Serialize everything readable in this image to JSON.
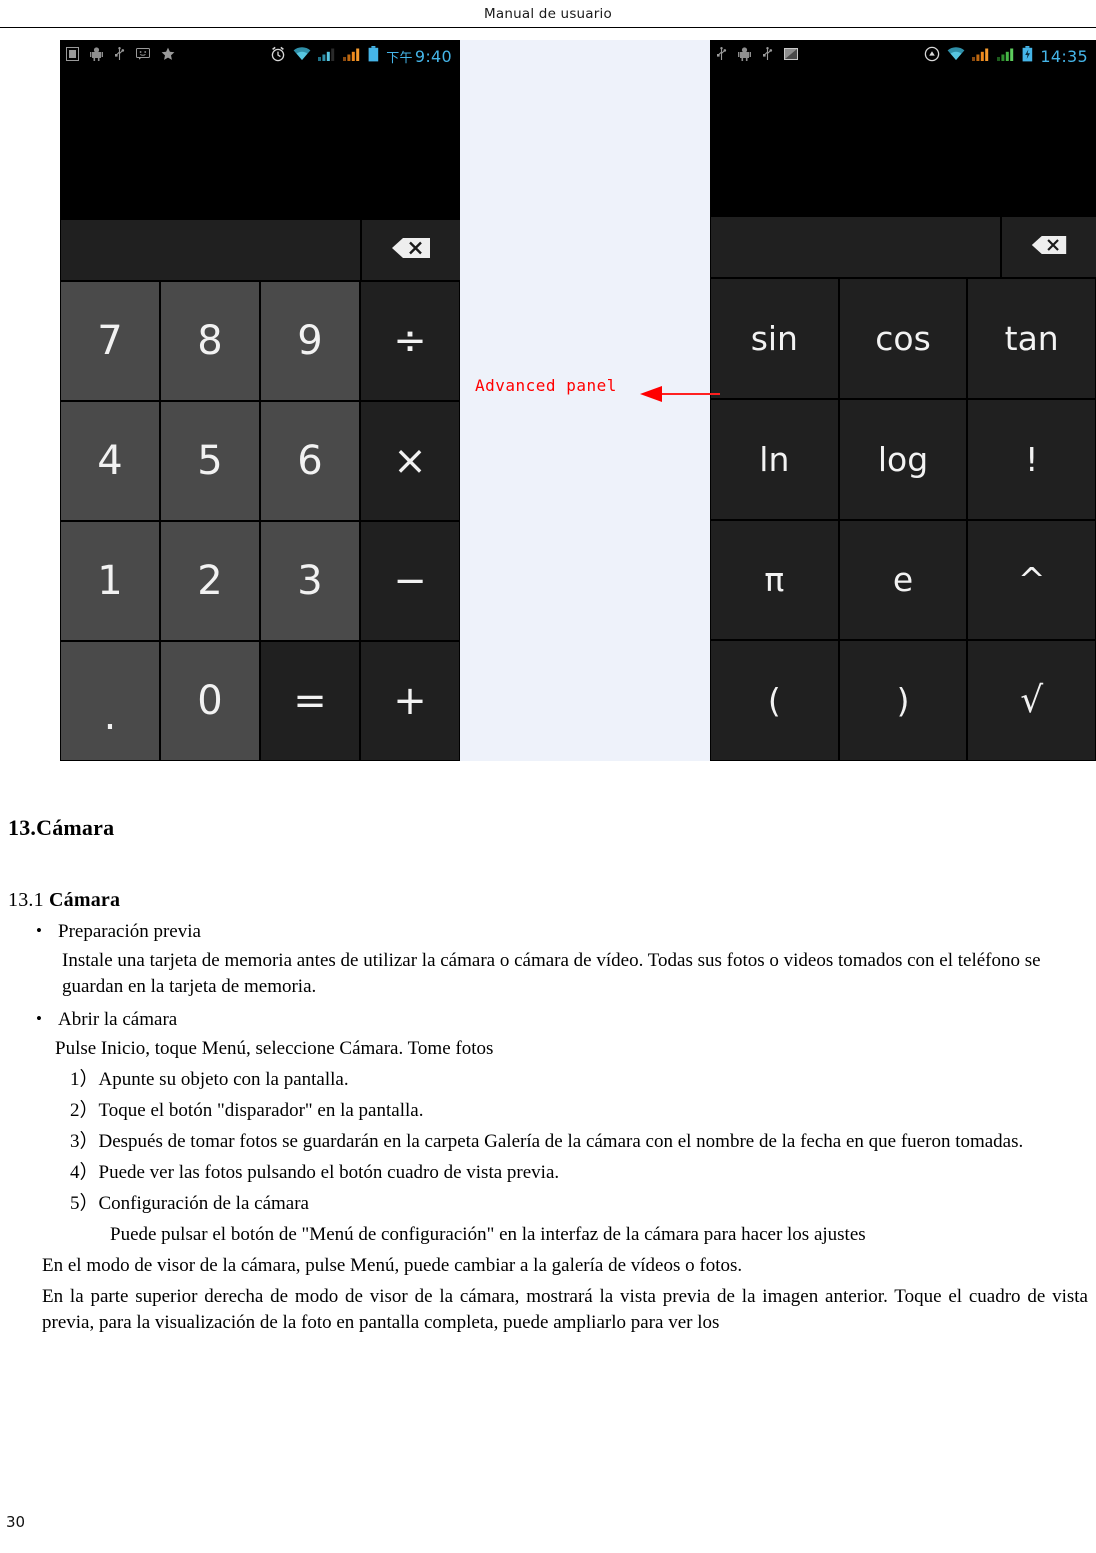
{
  "header": {
    "title": "Manual de usuario"
  },
  "figure": {
    "annotation": {
      "label": "Advanced panel",
      "color": "#ff0000"
    },
    "left_phone": {
      "statusbar": {
        "left_icons": [
          "sim-card-icon",
          "android-robot-icon",
          "usb-icon",
          "message-icon",
          "star-icon"
        ],
        "right_icons": [
          "alarm-clock-icon",
          "wifi-icon",
          "signal-bars-icon-1",
          "signal-bars-icon-2",
          "battery-icon"
        ],
        "ampm": "下午",
        "time": "9:40"
      },
      "delete_key": "backspace-icon",
      "keys": [
        [
          "7",
          "8",
          "9",
          "÷"
        ],
        [
          "4",
          "5",
          "6",
          "×"
        ],
        [
          "1",
          "2",
          "3",
          "−"
        ],
        [
          ".",
          "0",
          "=",
          "+"
        ]
      ]
    },
    "right_phone": {
      "statusbar": {
        "left_icons": [
          "usb-icon",
          "android-robot-icon",
          "usb-icon",
          "screenshot-icon"
        ],
        "right_icons": [
          "sync-icon",
          "wifi-icon",
          "signal-bars-icon-1",
          "signal-bars-icon-2",
          "battery-charging-icon"
        ],
        "ampm": "",
        "time": "14:35"
      },
      "delete_key": "backspace-icon",
      "keys": [
        [
          "sin",
          "cos",
          "tan"
        ],
        [
          "ln",
          "log",
          "!"
        ],
        [
          "π",
          "e",
          "^"
        ],
        [
          "(",
          ")",
          "√"
        ]
      ]
    }
  },
  "content": {
    "heading_section": "13.Cámara",
    "heading_sub_number": "13.1 ",
    "heading_sub_title": "Cámara",
    "bullet1": "Preparación previa",
    "para1": "Instale una tarjeta de memoria antes de utilizar la cámara o cámara de vídeo. Todas sus fotos o videos tomados con el teléfono se guardan en la tarjeta de memoria.",
    "bullet2": "Abrir la cámara",
    "para2": "Pulse Inicio, toque Menú, seleccione Cámara. Tome fotos",
    "item1": "1）Apunte su objeto con la pantalla.",
    "item2": "2）Toque el botón \"disparador\" en la pantalla.",
    "item3": "3）Después de tomar fotos se guardarán en la carpeta Galería de la cámara con el nombre de la fecha en que fueron tomadas.",
    "item4": "4）Puede ver las fotos pulsando el botón cuadro de vista previa.",
    "item5": "5）Configuración de la cámara",
    "item5_detail": "Puede pulsar el botón de \"Menú de configuración\" en la interfaz de la cámara para hacer los ajustes",
    "para3": "En el modo de visor de la cámara, pulse Menú, puede cambiar a la galería de vídeos o fotos.",
    "para4": "En la parte superior derecha de modo de visor de la cámara, mostrará la vista previa de la imagen anterior. Toque el cuadro de vista previa, para la visualización de la foto en pantalla completa, puede ampliarlo para ver los"
  },
  "footer": {
    "page_number": "30"
  }
}
